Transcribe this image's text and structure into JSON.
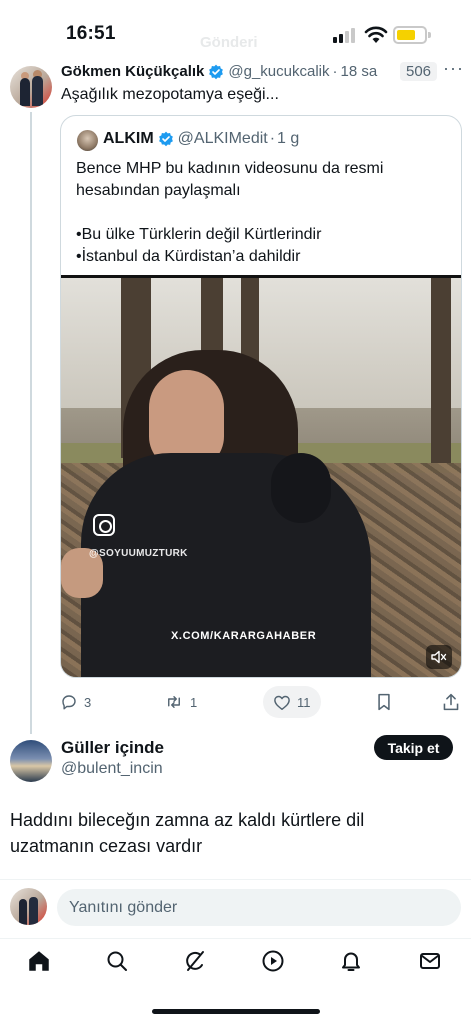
{
  "status_bar": {
    "time": "16:51",
    "faded_title": "Gönderi",
    "icons": [
      "signal-icon",
      "wifi-icon",
      "battery-icon"
    ]
  },
  "parent_tweet": {
    "author_name": "Gökmen Küçükçalık",
    "handle": "@g_kucukcalik",
    "separator": "·",
    "time": "18 sa",
    "views": "506",
    "text": "Aşağılık mezopotamya eşeği...",
    "quoted_tweet": {
      "author_name": "ALKIM",
      "handle": "@ALKIMedit",
      "separator": "·",
      "time": "1 g",
      "text_lines": [
        "Bence MHP bu kadının videosunu da resmi hesabından paylaşmalı",
        "",
        "•Bu ülke Türklerin değil Kürtlerindir",
        "•İstanbul da Kürdistan’a dahildir"
      ],
      "video": {
        "watermark_small": "@SOYUUMUZTURK",
        "watermark_large": "X.COM/KARARGAHABER",
        "muted": true
      }
    },
    "actions": {
      "replies": "3",
      "reposts": "1",
      "likes": "11",
      "icons": [
        "reply-icon",
        "repost-icon",
        "like-icon",
        "bookmark-icon",
        "share-icon"
      ]
    }
  },
  "reply": {
    "author_name": "Güller içinde",
    "handle": "@bulent_incin",
    "follow_label": "Takip et",
    "text": "Haddını bileceğın zamna az kaldı kürtlere dil uzatmanın cezası vardır"
  },
  "compose": {
    "placeholder": "Yanıtını gönder"
  },
  "bottom_nav": {
    "items": [
      "home-icon",
      "search-icon",
      "grok-icon",
      "video-icon",
      "notifications-icon",
      "messages-icon"
    ]
  },
  "colors": {
    "text_primary": "#0f1419",
    "text_secondary": "#536471",
    "verified_blue": "#1d9bf0",
    "border": "#cfd9de",
    "battery": "#f5d100"
  }
}
